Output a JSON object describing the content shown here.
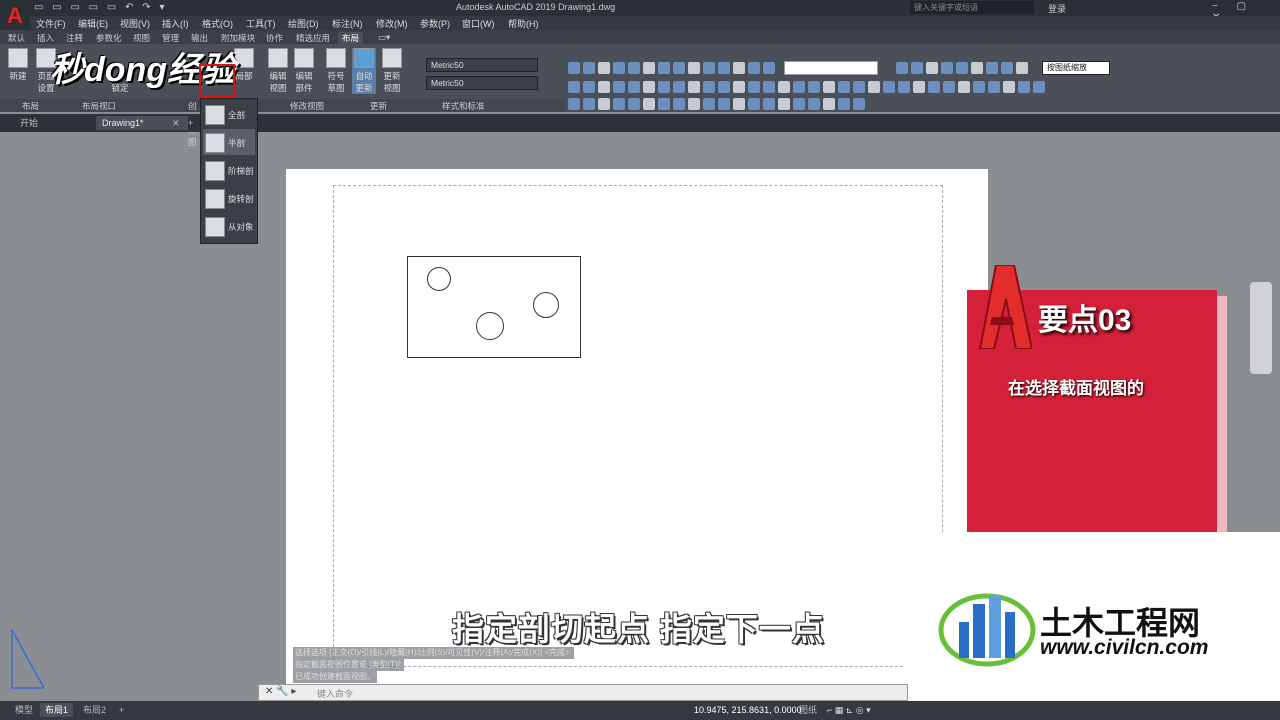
{
  "app": {
    "logo": "A",
    "title": "Autodesk AutoCAD 2019    Drawing1.dwg",
    "search_placeholder": "键入关键字或短语",
    "login": "登录",
    "window_controls": "− ▢ ✕"
  },
  "menu": [
    "文件(F)",
    "编辑(E)",
    "视图(V)",
    "插入(I)",
    "格式(O)",
    "工具(T)",
    "绘图(D)",
    "标注(N)",
    "修改(M)",
    "参数(P)",
    "窗口(W)",
    "帮助(H)"
  ],
  "ribbon_tabs": [
    "默认",
    "插入",
    "注释",
    "参数化",
    "视图",
    "管理",
    "输出",
    "附加模块",
    "协作",
    "精选应用",
    "布局"
  ],
  "active_ribbon_tab": "布局",
  "ribbon": {
    "new_label": "新建",
    "page_setup_label": "页面\n设置",
    "lock_label": "锁定",
    "part_label": "局部",
    "edit_view_label": "编辑\n视图",
    "edit_part_label": "编辑\n部件",
    "symbol_sketch_label": "符号\n草图",
    "auto_update_label": "自动\n更新",
    "update_view_label": "更新\n视图",
    "style_dropdown_1": "Metric50",
    "style_dropdown_2": "Metric50",
    "scale_dropdown": "按图纸缩放",
    "panels": [
      "布局",
      "布局视口",
      "创建视图",
      "修改视图",
      "更新",
      "样式和标准"
    ]
  },
  "doc_tabs": [
    "开始",
    "Drawing1*"
  ],
  "section_dropdown": {
    "items": [
      "全剖",
      "半剖",
      "阶梯剖",
      "旋转剖",
      "从对象"
    ],
    "hovered": "半剖"
  },
  "watermark": "秒dong经验",
  "overlay": {
    "card_title": "要点03",
    "card_text": "在选择截面视图的",
    "subtitle": "指定剖切起点 指定下一点",
    "site_name": "土木工程网",
    "site_url": "www.civilcn.com"
  },
  "command": {
    "history": [
      "选择选项 [正交(O)/引线(L)/隐藏(H)/比例(S)/可见性(V)/注释(A)/完成(X)] <完成>:",
      "指定截面视图位置或 [类型(T)]:",
      "已成功创建截面视图。"
    ],
    "placeholder": "键入命令"
  },
  "status": {
    "layout_tabs": [
      "模型",
      "布局1",
      "布局2"
    ],
    "active_layout": "布局1",
    "coords": "10.9475, 215.8631, 0.0000",
    "paper_label": "图纸"
  }
}
